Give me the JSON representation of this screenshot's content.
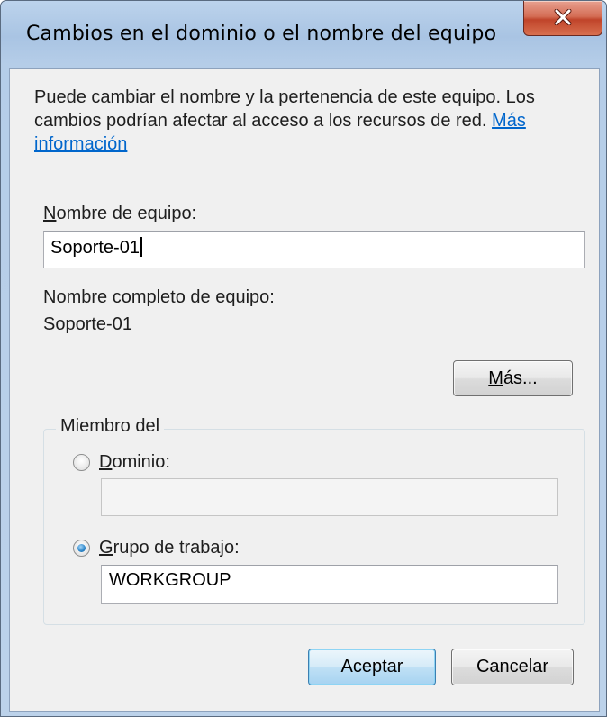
{
  "window": {
    "title": "Cambios en el dominio o el nombre del equipo"
  },
  "description": {
    "text": "Puede cambiar el nombre y la pertenencia de este equipo. Los cambios podrían afectar al acceso a los recursos de red. ",
    "link": "Más información"
  },
  "computer_name": {
    "label_accel": "N",
    "label_rest": "ombre de equipo:",
    "value": "Soporte-01"
  },
  "full_name": {
    "label": "Nombre completo de equipo:",
    "value": "Soporte-01"
  },
  "more_button": {
    "accel": "M",
    "rest": "ás..."
  },
  "member_of": {
    "legend": "Miembro del",
    "domain": {
      "accel": "D",
      "rest": "ominio:",
      "selected": false,
      "value": ""
    },
    "workgroup": {
      "accel": "G",
      "rest": "rupo de trabajo:",
      "selected": true,
      "value": "WORKGROUP"
    }
  },
  "buttons": {
    "ok": "Aceptar",
    "cancel": "Cancelar"
  },
  "icons": {
    "close": "close-icon"
  }
}
